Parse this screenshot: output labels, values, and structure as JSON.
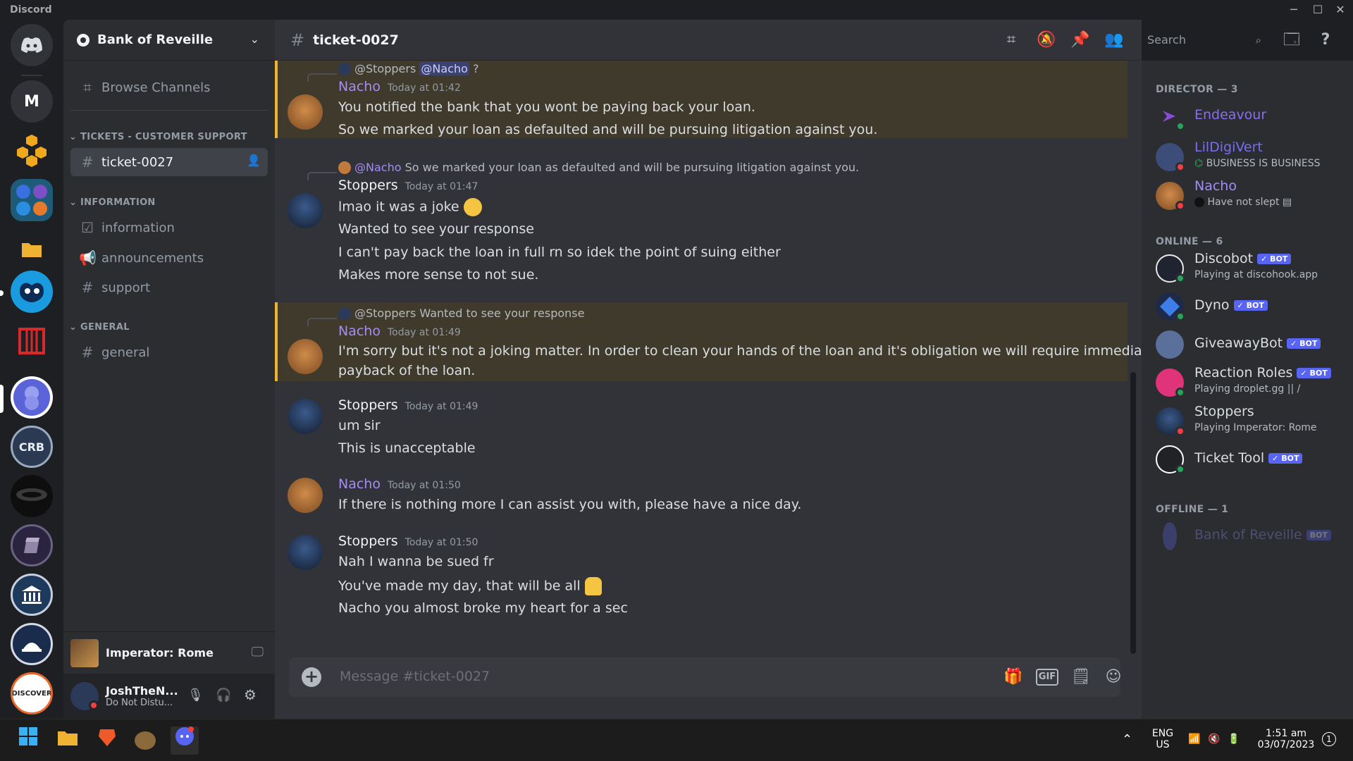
{
  "app": {
    "title": "Discord"
  },
  "window_controls": {
    "minimize": "─",
    "maximize": "☐",
    "close": "✕"
  },
  "servers": [
    {
      "label": "M"
    },
    {
      "label": "DISCOVER"
    }
  ],
  "guild": {
    "name": "Bank of Reveille"
  },
  "sidebar": {
    "browse": "Browse Channels",
    "categories": {
      "tickets": "TICKETS - CUSTOMER SUPPORT",
      "information": "INFORMATION",
      "general": "GENERAL"
    },
    "channels": {
      "ticket": "ticket-0027",
      "information": "information",
      "announcements": "announcements",
      "support": "support",
      "general": "general"
    }
  },
  "activity": {
    "game": "Imperator: Rome"
  },
  "user": {
    "name": "JoshTheN...",
    "status": "Do Not Distu..."
  },
  "channel": {
    "name": "ticket-0027"
  },
  "search": {
    "placeholder": "Search"
  },
  "messages": {
    "m1": {
      "reply_user": "@Stoppers",
      "reply_mention": "@Nacho",
      "reply_text": "?",
      "author": "Nacho",
      "time": "Today at 01:42",
      "lines": [
        "You notified the bank that you wont be paying back your loan.",
        "So we marked your loan as defaulted and will be pursuing litigation against you."
      ]
    },
    "m2": {
      "reply_user": "@Nacho",
      "reply_text": "So we marked your loan as defaulted and will be pursuing litigation against you.",
      "author": "Stoppers",
      "time": "Today at 01:47",
      "lines": [
        "lmao it was a joke",
        "Wanted to see your response",
        "I can't pay back the loan in full rn so idek the point of suing either",
        "Makes more sense to not sue."
      ]
    },
    "m3": {
      "reply_user": "@Stoppers",
      "reply_text": "Wanted to see your response",
      "author": "Nacho",
      "time": "Today at 01:49",
      "lines": [
        "I'm sorry but it's not a joking matter. In order to clean your hands of the loan and it's obligation we will require immediate",
        "payback of the loan."
      ]
    },
    "m4": {
      "author": "Stoppers",
      "time": "Today at 01:49",
      "lines": [
        "um sir",
        "This is unacceptable"
      ]
    },
    "m5": {
      "author": "Nacho",
      "time": "Today at 01:50",
      "lines": [
        "If there is nothing more I can assist you with, please have a nice day."
      ]
    },
    "m6": {
      "author": "Stoppers",
      "time": "Today at 01:50",
      "lines": [
        "Nah I wanna be sued fr",
        "You've made my day, that will be all",
        "Nacho you almost broke my heart for a sec"
      ]
    }
  },
  "composer": {
    "placeholder": "Message #ticket-0027",
    "gif": "GIF"
  },
  "members": {
    "director_header": "DIRECTOR — 3",
    "online_header": "ONLINE — 6",
    "offline_header": "OFFLINE — 1",
    "bot_tag": "✓ BOT",
    "offline_bot_tag": "BOT",
    "endeavour": {
      "name": "Endeavour"
    },
    "lildigivert": {
      "name": "LilDigiVert",
      "status": "BUSINESS IS BUSINESS"
    },
    "nacho": {
      "name": "Nacho",
      "status": "Have not slept"
    },
    "discobot": {
      "name": "Discobot",
      "status": "Playing at discohook.app"
    },
    "dyno": {
      "name": "Dyno"
    },
    "giveawaybot": {
      "name": "GiveawayBot"
    },
    "reactionroles": {
      "name": "Reaction Roles",
      "status": "Playing droplet.gg || /"
    },
    "stoppers": {
      "name": "Stoppers",
      "status": "Playing Imperator: Rome"
    },
    "tickettool": {
      "name": "Ticket Tool"
    },
    "bankofreveille": {
      "name": "Bank of Reveille"
    }
  },
  "taskbar": {
    "lang": "ENG",
    "region": "US",
    "time": "1:51 am",
    "date": "03/07/2023",
    "notifications": "1"
  },
  "colors": {
    "accent": "#5865f2",
    "nacho": "#a58cf5",
    "highlight_bar": "#f0b232",
    "dnd": "#f23f43",
    "online": "#23a55a"
  }
}
